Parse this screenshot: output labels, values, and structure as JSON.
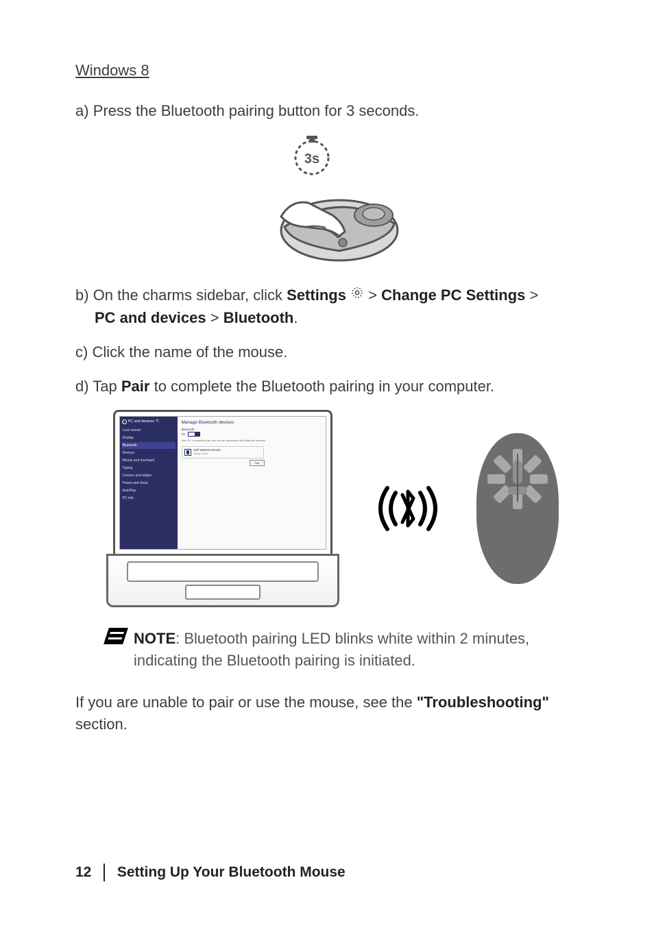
{
  "heading": "Windows 8",
  "steps": {
    "a": {
      "letter": "a)",
      "text": "Press the Bluetooth pairing button for 3 seconds."
    },
    "b": {
      "letter": "b)",
      "pre": "On the charms sidebar, click ",
      "settings": "Settings",
      "sep1": " > ",
      "change": "Change PC Settings",
      "sep2": " > ",
      "pcdev": "PC and devices",
      "sep3": " > ",
      "bt": "Bluetooth",
      "period": "."
    },
    "c": {
      "letter": "c)",
      "text": "Click the name of the mouse."
    },
    "d": {
      "letter": "d)",
      "pre": "Tap ",
      "pair": "Pair",
      "post": " to complete the Bluetooth pairing in your computer."
    }
  },
  "timer_label": "3s",
  "settings_screen": {
    "sidebar_header": "PC and devices",
    "items": [
      "Lock screen",
      "Display",
      "Bluetooth",
      "Devices",
      "Mouse and touchpad",
      "Typing",
      "Corners and edges",
      "Power and sleep",
      "AutoPlay",
      "PC info"
    ],
    "active_index": 2,
    "content_title": "Manage Bluetooth devices",
    "toggle_label": "Bluetooth",
    "toggle_state": "On",
    "hint": "Your PC is searching for and can be discovered by Bluetooth devices.",
    "device_name": "Dell WM615 Mouse",
    "device_status": "Ready to pair",
    "pair_button": "Pair"
  },
  "note": {
    "label": "NOTE",
    "text": ": Bluetooth pairing LED blinks white within 2 minutes, indicating the Bluetooth pairing is initiated."
  },
  "troubleshoot": {
    "pre": "If you are unable to pair or use the mouse, see the ",
    "link": "\"Troubleshooting\"",
    "post": " section."
  },
  "footer": {
    "page": "12",
    "title": "Setting Up Your Bluetooth Mouse"
  }
}
